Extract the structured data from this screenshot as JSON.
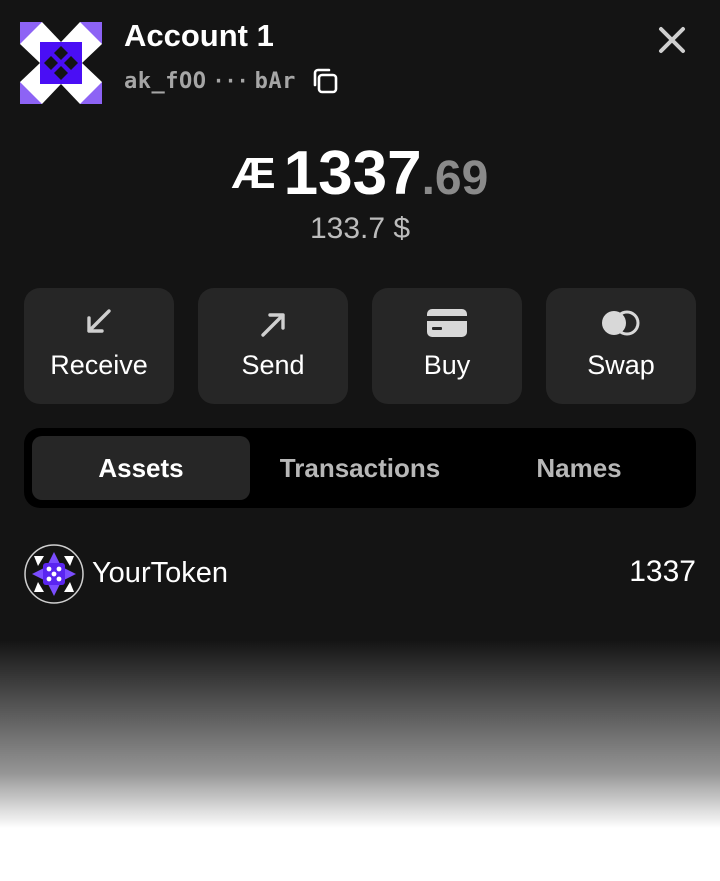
{
  "header": {
    "account_name": "Account 1",
    "address_start": "ak_fOO",
    "address_ellipsis": "···",
    "address_end": "bAr",
    "icons": [
      "account-avatar",
      "copy-icon",
      "close-icon"
    ]
  },
  "balance": {
    "currency_symbol": "Æ",
    "integer": "1337",
    "decimal": ".69",
    "fiat": "133.7 $"
  },
  "actions": [
    {
      "label": "Receive",
      "icon": "arrow-down-left-icon"
    },
    {
      "label": "Send",
      "icon": "arrow-up-right-icon"
    },
    {
      "label": "Buy",
      "icon": "card-icon"
    },
    {
      "label": "Swap",
      "icon": "swap-icon"
    }
  ],
  "tabs": [
    {
      "label": "Assets",
      "active": true
    },
    {
      "label": "Transactions",
      "active": false
    },
    {
      "label": "Names",
      "active": false
    }
  ],
  "assets": [
    {
      "name": "YourToken",
      "amount": "1337",
      "icon": "token-icon"
    }
  ],
  "colors": {
    "background": "#141414",
    "card": "#262626",
    "tab_bar": "#000000",
    "accent_purple": "#7b4dff",
    "muted_text": "#a6a6a6"
  }
}
